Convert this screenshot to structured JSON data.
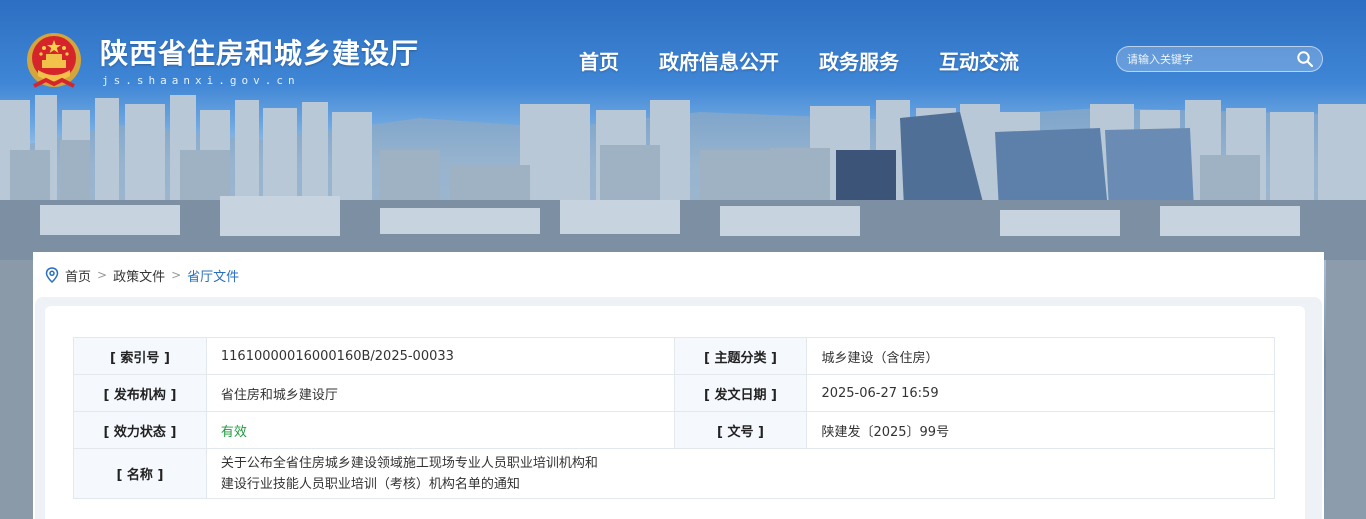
{
  "header": {
    "site_title": "陕西省住房和城乡建设厅",
    "site_domain": "js.shaanxi.gov.cn",
    "nav": [
      "首页",
      "政府信息公开",
      "政务服务",
      "互动交流"
    ],
    "search_placeholder": "请输入关键字",
    "icons": {
      "emblem": "national-emblem-icon",
      "search": "search-icon"
    }
  },
  "breadcrumb": {
    "icon": "location-pin-icon",
    "items": [
      "首页",
      "政策文件",
      "省厅文件"
    ],
    "separator": ">"
  },
  "meta": {
    "rows": [
      {
        "k1": "[ 索引号 ]",
        "v1": "11610000016000160B/2025-00033",
        "k2": "[ 主题分类 ]",
        "v2": "城乡建设（含住房）"
      },
      {
        "k1": "[ 发布机构 ]",
        "v1": "省住房和城乡建设厅",
        "k2": "[ 发文日期 ]",
        "v2": "2025-06-27 16:59"
      },
      {
        "k1": "[ 效力状态 ]",
        "v1": "有效",
        "k2": "[ 文号 ]",
        "v2": "陕建发〔2025〕99号"
      }
    ],
    "name_key": "[ 名称 ]",
    "name_lines": [
      "关于公布全省住房城乡建设领域施工现场专业人员职业培训机构和",
      "建设行业技能人员职业培训（考核）机构名单的通知"
    ]
  },
  "colors": {
    "link_blue": "#2a6fbf",
    "status_green": "#1e9a3e",
    "header_blue": "#2d6fc2"
  }
}
